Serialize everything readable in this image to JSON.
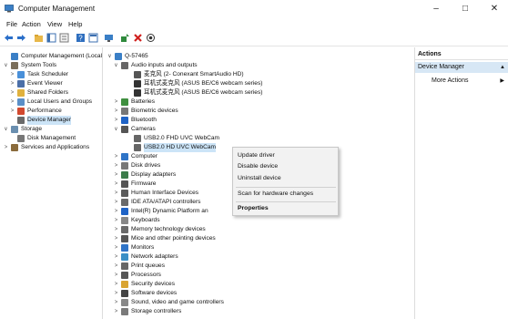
{
  "window": {
    "title": "Computer Management",
    "minimize": "–",
    "maximize": "□",
    "close": "✕"
  },
  "menu": [
    "File",
    "Action",
    "View",
    "Help"
  ],
  "colors": {
    "selection": "#cce4f7",
    "actions_sub_bg": "#d7e7f5",
    "context_bg": "#f2f2f2"
  },
  "left_tree": [
    {
      "label": "Computer Management (Local",
      "icon": "computer-management-icon",
      "exp": ""
    },
    {
      "label": "System Tools",
      "icon": "system-tools-icon",
      "exp": "∨"
    },
    {
      "label": "Task Scheduler",
      "icon": "clock-icon",
      "exp": ">"
    },
    {
      "label": "Event Viewer",
      "icon": "event-viewer-icon",
      "exp": ">"
    },
    {
      "label": "Shared Folders",
      "icon": "folder-icon",
      "exp": ">"
    },
    {
      "label": "Local Users and Groups",
      "icon": "users-icon",
      "exp": ">"
    },
    {
      "label": "Performance",
      "icon": "performance-icon",
      "exp": ">"
    },
    {
      "label": "Device Manager",
      "icon": "device-manager-icon",
      "exp": ""
    },
    {
      "label": "Storage",
      "icon": "storage-icon",
      "exp": "∨"
    },
    {
      "label": "Disk Management",
      "icon": "disk-management-icon",
      "exp": ""
    },
    {
      "label": "Services and Applications",
      "icon": "services-icon",
      "exp": ">"
    }
  ],
  "device_tree": [
    {
      "label": "Q-57465",
      "icon": "computer-icon",
      "exp": "∨"
    },
    {
      "label": "Audio inputs and outputs",
      "icon": "audio-icon",
      "exp": "∨"
    },
    {
      "label": "麦克风 (2- Conexant SmartAudio HD)",
      "icon": "microphone-icon",
      "exp": ""
    },
    {
      "label": "耳机式麦克风 (ASUS BE/C6 webcam series)",
      "icon": "speaker-icon",
      "exp": ""
    },
    {
      "label": "耳机式麦克风 (ASUS BE/C6 webcam series)",
      "icon": "speaker-icon",
      "exp": ""
    },
    {
      "label": "Batteries",
      "icon": "battery-icon",
      "exp": ">"
    },
    {
      "label": "Biometric devices",
      "icon": "biometric-icon",
      "exp": ">"
    },
    {
      "label": "Bluetooth",
      "icon": "bluetooth-icon",
      "exp": ">"
    },
    {
      "label": "Cameras",
      "icon": "camera-icon",
      "exp": "∨"
    },
    {
      "label": "USB2.0 FHD UVC WebCam",
      "icon": "webcam-icon",
      "exp": ""
    },
    {
      "label": "USB2.0 HD UVC WebCam",
      "icon": "webcam-icon",
      "exp": ""
    },
    {
      "label": "Computer",
      "icon": "monitor-icon",
      "exp": ">"
    },
    {
      "label": "Disk drives",
      "icon": "disk-icon",
      "exp": ">"
    },
    {
      "label": "Display adapters",
      "icon": "display-adapter-icon",
      "exp": ">"
    },
    {
      "label": "Firmware",
      "icon": "firmware-icon",
      "exp": ">"
    },
    {
      "label": "Human Interface Devices",
      "icon": "hid-icon",
      "exp": ">"
    },
    {
      "label": "IDE ATA/ATAPI controllers",
      "icon": "ide-icon",
      "exp": ">"
    },
    {
      "label": "Intel(R) Dynamic Platform an",
      "icon": "intel-icon",
      "exp": ">"
    },
    {
      "label": "Keyboards",
      "icon": "keyboard-icon",
      "exp": ">"
    },
    {
      "label": "Memory technology devices",
      "icon": "memory-icon",
      "exp": ">"
    },
    {
      "label": "Mice and other pointing devices",
      "icon": "mouse-icon",
      "exp": ">"
    },
    {
      "label": "Monitors",
      "icon": "monitor-icon",
      "exp": ">"
    },
    {
      "label": "Network adapters",
      "icon": "network-icon",
      "exp": ">"
    },
    {
      "label": "Print queues",
      "icon": "printer-icon",
      "exp": ">"
    },
    {
      "label": "Processors",
      "icon": "processor-icon",
      "exp": ">"
    },
    {
      "label": "Security devices",
      "icon": "security-icon",
      "exp": ">"
    },
    {
      "label": "Software devices",
      "icon": "software-icon",
      "exp": ">"
    },
    {
      "label": "Sound, video and game controllers",
      "icon": "sound-icon",
      "exp": ">"
    },
    {
      "label": "Storage controllers",
      "icon": "storage-controller-icon",
      "exp": ">"
    }
  ],
  "actions": {
    "header": "Actions",
    "sub": "Device Manager",
    "more": "More Actions"
  },
  "context_menu": [
    "Update driver",
    "Disable device",
    "Uninstall device",
    "Scan for hardware changes",
    "Properties"
  ]
}
